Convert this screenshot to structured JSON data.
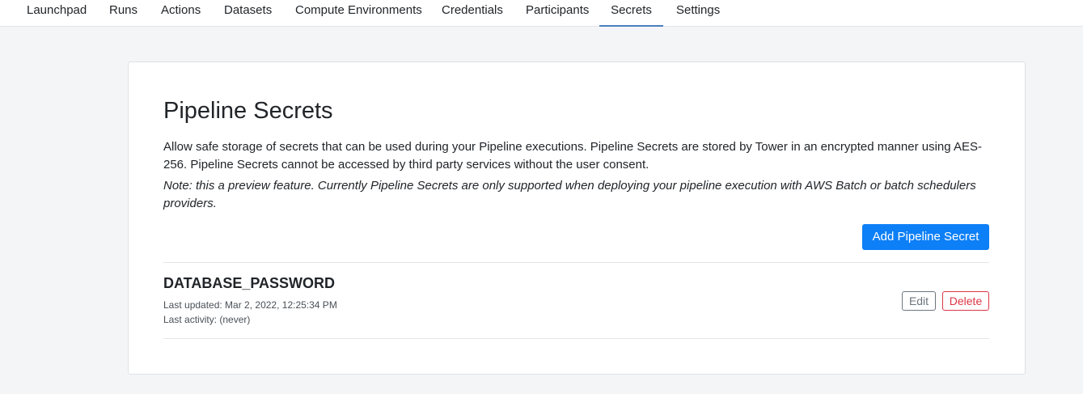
{
  "nav": {
    "tabs": [
      {
        "label": "Launchpad"
      },
      {
        "label": "Runs"
      },
      {
        "label": "Actions"
      },
      {
        "label": "Datasets"
      },
      {
        "label": "Compute Environments"
      },
      {
        "label": "Credentials"
      },
      {
        "label": "Participants"
      },
      {
        "label": "Secrets",
        "active": true
      },
      {
        "label": "Settings"
      }
    ]
  },
  "page": {
    "title": "Pipeline Secrets",
    "description": "Allow safe storage of secrets that can be used during your Pipeline executions. Pipeline Secrets are stored by Tower in an encrypted manner using AES-256. Pipeline Secrets cannot be accessed by third party services without the user consent.",
    "note": "Note: this a preview feature. Currently Pipeline Secrets are only supported when deploying your pipeline execution with AWS Batch or batch schedulers providers.",
    "add_button": "Add Pipeline Secret"
  },
  "secrets": [
    {
      "name": "DATABASE_PASSWORD",
      "last_updated": "Last updated: Mar 2, 2022, 12:25:34 PM",
      "last_activity": "Last activity: (never)",
      "edit_label": "Edit",
      "delete_label": "Delete"
    }
  ],
  "colors": {
    "primary": "#0d7ff7",
    "danger": "#dc3545",
    "secondary": "#6c757d",
    "active_tab_underline": "#4a7fc1"
  }
}
